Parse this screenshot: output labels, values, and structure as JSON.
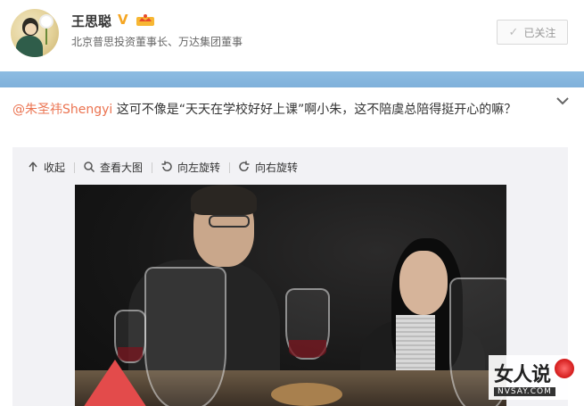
{
  "profile": {
    "name": "王思聪",
    "verified_badge": "V",
    "bio": "北京普思投资董事长、万达集团董事",
    "follow_label": "已关注"
  },
  "post": {
    "mention": "@朱圣祎Shengyi",
    "text": " 这可不像是“天天在学校好好上课”啊小朱，这不陪虞总陪得挺开心的嘛？"
  },
  "toolbar": {
    "collapse": "收起",
    "view_large": "查看大图",
    "rotate_left": "向左旋转",
    "rotate_right": "向右旋转"
  },
  "watermark": {
    "main": "女人说",
    "sub": "NVSAY.COM"
  },
  "colors": {
    "accent": "#eb7350",
    "band": "#86b6de",
    "verified": "#f5a623"
  }
}
